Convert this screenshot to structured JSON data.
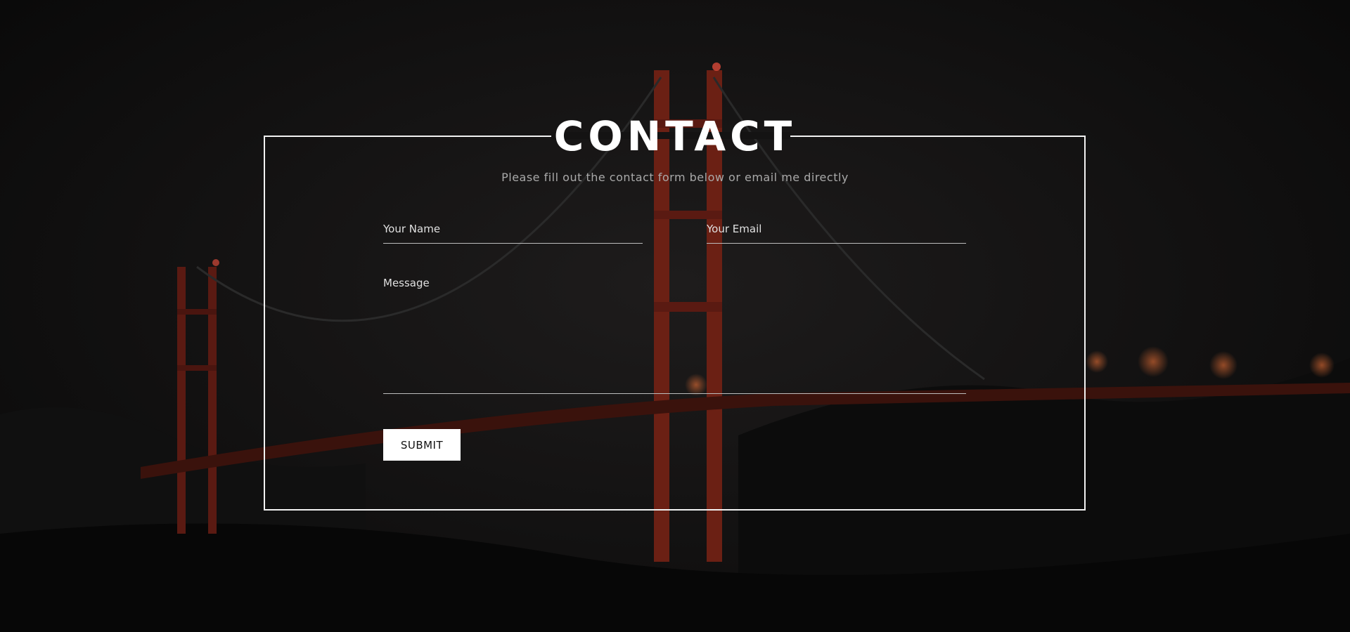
{
  "page": {
    "title": "CONTACT",
    "subtitle": "Please fill out the contact form below or email me directly"
  },
  "form": {
    "name_placeholder": "Your Name",
    "email_placeholder": "Your Email",
    "message_placeholder": "Message",
    "name_value": "",
    "email_value": "",
    "message_value": "",
    "submit_label": "SUBMIT"
  },
  "colors": {
    "background": "#0b0a0a",
    "accent_bridge": "#8a2a1a",
    "text": "#ffffff",
    "muted_text": "#a9a9a9"
  }
}
